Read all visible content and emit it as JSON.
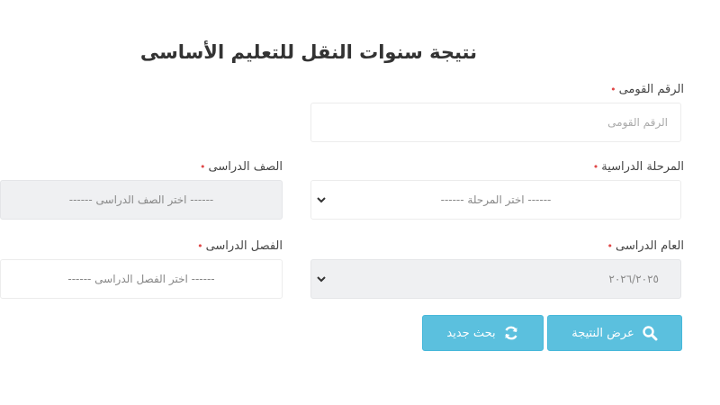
{
  "page": {
    "title": "نتيجة سنوات النقل للتعليم الأساسى"
  },
  "form": {
    "required_mark": "•",
    "national_id": {
      "label": "الرقم القومى",
      "placeholder": "الرقم القومى",
      "value": ""
    },
    "stage": {
      "label": "المرحلة الدراسية",
      "selected": "------ اختر المرحلة ------"
    },
    "grade": {
      "label": "الصف الدراسى",
      "selected": "------ اختر الصف الدراسى ------"
    },
    "year": {
      "label": "العام الدراسى",
      "selected": "٢٠٢٦/٢٠٢٥"
    },
    "term": {
      "label": "الفصل الدراسى",
      "selected": "------ اختر الفصل الدراسى ------"
    }
  },
  "buttons": {
    "show_result": {
      "label": "عرض النتيجة",
      "icon": "search-icon"
    },
    "new_search": {
      "label": "بحث جديد",
      "icon": "refresh-icon"
    }
  },
  "colors": {
    "button_bg": "#5bc0de",
    "required": "#e04848",
    "disabled_field_bg": "#eff0f2"
  }
}
